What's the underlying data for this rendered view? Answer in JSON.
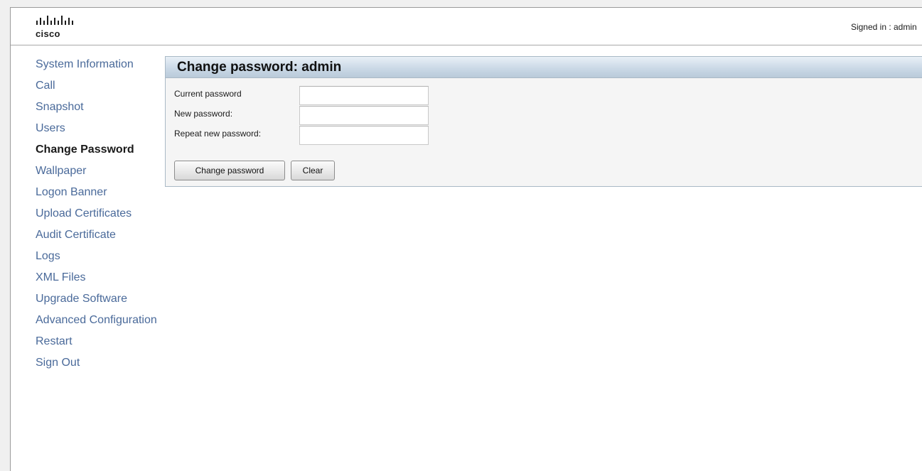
{
  "header": {
    "logo_text": "cisco",
    "signed_in_label": "Signed in : ",
    "signed_in_user": "admin"
  },
  "sidebar": {
    "items": [
      {
        "label": "System Information",
        "active": false
      },
      {
        "label": "Call",
        "active": false
      },
      {
        "label": "Snapshot",
        "active": false
      },
      {
        "label": "Users",
        "active": false
      },
      {
        "label": "Change Password",
        "active": true
      },
      {
        "label": "Wallpaper",
        "active": false
      },
      {
        "label": "Logon Banner",
        "active": false
      },
      {
        "label": "Upload Certificates",
        "active": false
      },
      {
        "label": "Audit Certificate",
        "active": false
      },
      {
        "label": "Logs",
        "active": false
      },
      {
        "label": "XML Files",
        "active": false
      },
      {
        "label": "Upgrade Software",
        "active": false
      },
      {
        "label": "Advanced Configuration",
        "active": false
      },
      {
        "label": "Restart",
        "active": false
      },
      {
        "label": "Sign Out",
        "active": false
      }
    ]
  },
  "panel": {
    "title": "Change password: admin",
    "fields": [
      {
        "label": "Current password",
        "value": ""
      },
      {
        "label": "New password:",
        "value": ""
      },
      {
        "label": "Repeat new password:",
        "value": ""
      }
    ],
    "change_button": "Change password",
    "clear_button": "Clear"
  },
  "colors": {
    "nav_link": "#4a6a9a",
    "nav_active": "#1a1a1a",
    "panel_header": "#cbd9e7",
    "panel_border": "#a9b9c6"
  },
  "icons": {
    "logo": "cisco-logo-icon"
  }
}
